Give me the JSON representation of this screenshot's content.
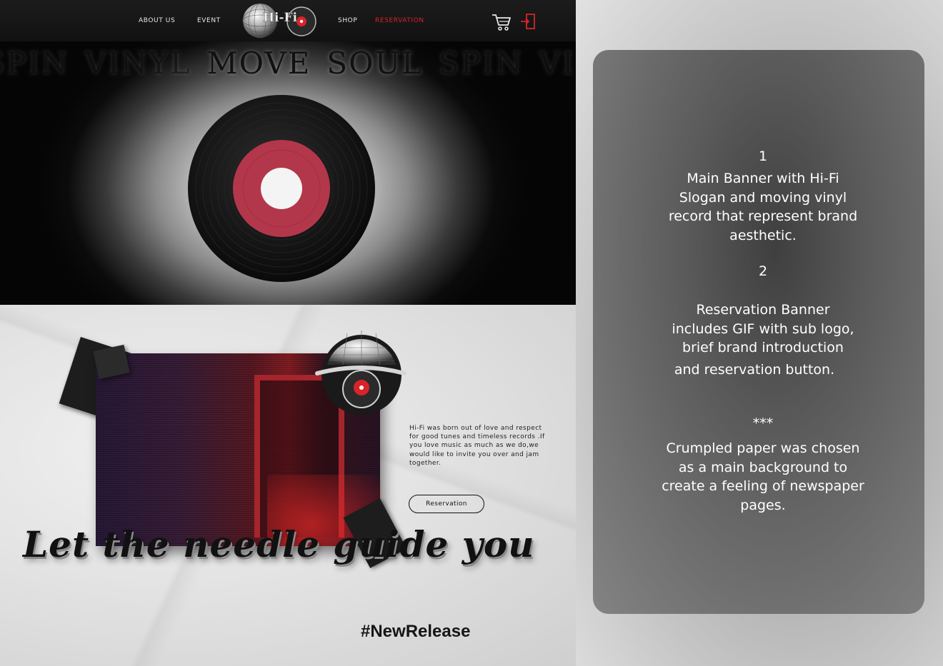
{
  "nav": {
    "about": "ABOUT US",
    "event": "EVENT",
    "logo_text": "Hi-Fi",
    "shop": "SHOP",
    "reservation": "RESERVATION",
    "active_color": "#d8232a"
  },
  "hero": {
    "slogan_words": [
      "SPIN",
      "VINYL",
      "MOVE",
      "SOUL",
      "SPIN",
      "VI"
    ]
  },
  "reservation_section": {
    "intro": "Hi-Fi was born out of love and respect for good tunes and timeless records .If you love music as much as we do,we would like to invite you over and jam together.",
    "button_label": "Reservation",
    "tagline": "Let the needle guide you",
    "hashtag": "#NewRelease"
  },
  "description": {
    "section1_number": "1",
    "section1_text": "Main Banner with Hi-Fi\nSlogan and moving vinyl\nrecord that represent brand\naesthetic.",
    "section2_number": "2",
    "section2_text": "Reservation Banner\nincludes GIF with sub logo,\nbrief brand introduction",
    "section2_text_tail": "and reservation button.",
    "divider": "***",
    "section3_text": "Crumpled paper was chosen\nas a main background to\ncreate a feeling of newspaper\npages."
  },
  "icons": {
    "cart": "shopping-cart-icon",
    "logout": "logout-icon"
  }
}
